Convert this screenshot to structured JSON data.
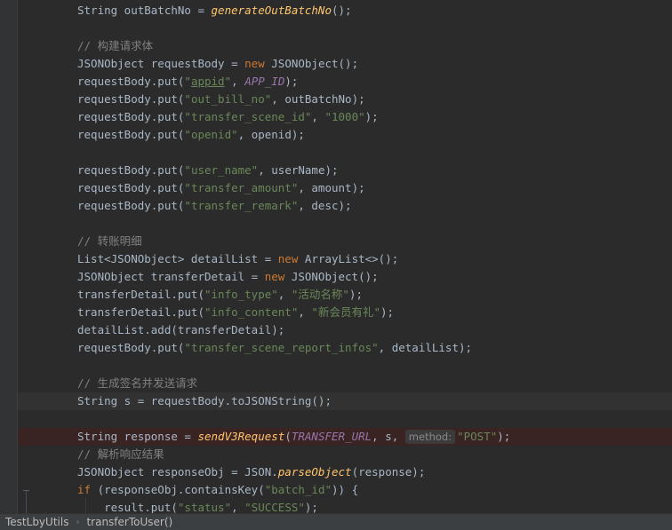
{
  "editor": {
    "lines": [
      {
        "parts": [
          [
            "t",
            "String outBatchNo = "
          ],
          [
            "mi",
            "generateOutBatchNo"
          ],
          [
            "t",
            "();"
          ]
        ]
      },
      {
        "parts": []
      },
      {
        "parts": [
          [
            "c",
            "// 构建请求体"
          ]
        ]
      },
      {
        "parts": [
          [
            "t",
            "JSONObject requestBody = "
          ],
          [
            "k",
            "new "
          ],
          [
            "t",
            "JSONObject();"
          ]
        ]
      },
      {
        "parts": [
          [
            "t",
            "requestBody.put("
          ],
          [
            "s",
            "\""
          ],
          [
            "su",
            "appid"
          ],
          [
            "s",
            "\""
          ],
          [
            "t",
            ", "
          ],
          [
            "ci",
            "APP_ID"
          ],
          [
            "t",
            ");"
          ]
        ]
      },
      {
        "parts": [
          [
            "t",
            "requestBody.put("
          ],
          [
            "s",
            "\"out_bill_no\""
          ],
          [
            "t",
            ", outBatchNo);"
          ]
        ]
      },
      {
        "parts": [
          [
            "t",
            "requestBody.put("
          ],
          [
            "s",
            "\"transfer_scene_id\""
          ],
          [
            "t",
            ", "
          ],
          [
            "s",
            "\"1000\""
          ],
          [
            "t",
            ");"
          ]
        ]
      },
      {
        "parts": [
          [
            "t",
            "requestBody.put("
          ],
          [
            "s",
            "\"openid\""
          ],
          [
            "t",
            ", openid);"
          ]
        ]
      },
      {
        "parts": []
      },
      {
        "parts": [
          [
            "t",
            "requestBody.put("
          ],
          [
            "s",
            "\"user_name\""
          ],
          [
            "t",
            ", userName);"
          ]
        ]
      },
      {
        "parts": [
          [
            "t",
            "requestBody.put("
          ],
          [
            "s",
            "\"transfer_amount\""
          ],
          [
            "t",
            ", amount);"
          ]
        ]
      },
      {
        "parts": [
          [
            "t",
            "requestBody.put("
          ],
          [
            "s",
            "\"transfer_remark\""
          ],
          [
            "t",
            ", desc);"
          ]
        ]
      },
      {
        "parts": []
      },
      {
        "parts": [
          [
            "c",
            "// 转账明细"
          ]
        ]
      },
      {
        "parts": [
          [
            "t",
            "List<JSONObject> detailList = "
          ],
          [
            "k",
            "new "
          ],
          [
            "t",
            "ArrayList<>();"
          ]
        ]
      },
      {
        "parts": [
          [
            "t",
            "JSONObject transferDetail = "
          ],
          [
            "k",
            "new "
          ],
          [
            "t",
            "JSONObject();"
          ]
        ]
      },
      {
        "parts": [
          [
            "t",
            "transferDetail.put("
          ],
          [
            "s",
            "\"info_type\""
          ],
          [
            "t",
            ", "
          ],
          [
            "s",
            "\"活动名称\""
          ],
          [
            "t",
            ");"
          ]
        ]
      },
      {
        "parts": [
          [
            "t",
            "transferDetail.put("
          ],
          [
            "s",
            "\"info_content\""
          ],
          [
            "t",
            ", "
          ],
          [
            "s",
            "\"新会员有礼\""
          ],
          [
            "t",
            ");"
          ]
        ]
      },
      {
        "parts": [
          [
            "t",
            "detailList.add(transferDetail);"
          ]
        ]
      },
      {
        "parts": [
          [
            "t",
            "requestBody.put("
          ],
          [
            "s",
            "\"transfer_scene_report_infos\""
          ],
          [
            "t",
            ", detailList);"
          ]
        ]
      },
      {
        "parts": []
      },
      {
        "parts": [
          [
            "c",
            "// 生成签名并发送请求"
          ]
        ]
      },
      {
        "parts": [
          [
            "t",
            "String s = requestBody.toJSONString();"
          ]
        ],
        "current": true
      },
      {
        "parts": []
      },
      {
        "parts": [
          [
            "t",
            "String response = "
          ],
          [
            "mi",
            "sendV3Request"
          ],
          [
            "t",
            "("
          ],
          [
            "ci",
            "TRANSFER_URL"
          ],
          [
            "t",
            ", s, "
          ],
          [
            "h",
            "method:"
          ],
          [
            "s",
            "\"POST\""
          ],
          [
            "t",
            ");"
          ]
        ],
        "breakpoint": true
      },
      {
        "parts": [
          [
            "c",
            "// 解析响应结果"
          ]
        ]
      },
      {
        "parts": [
          [
            "t",
            "JSONObject responseObj = JSON."
          ],
          [
            "mi",
            "parseObject"
          ],
          [
            "t",
            "(response);"
          ]
        ]
      },
      {
        "parts": [
          [
            "k",
            "if "
          ],
          [
            "t",
            "(responseObj.containsKey("
          ],
          [
            "s",
            "\"batch_id\""
          ],
          [
            "t",
            ")) {"
          ]
        ]
      },
      {
        "parts": [
          [
            "t",
            "    result.put("
          ],
          [
            "s",
            "\"status\""
          ],
          [
            "t",
            ", "
          ],
          [
            "s",
            "\"SUCCESS\""
          ],
          [
            "t",
            ");"
          ]
        ]
      }
    ]
  },
  "breadcrumb": {
    "file": "TestLbyUtils",
    "method": "transferToUser()"
  },
  "colors": {
    "background": "#2b2b2b",
    "keyword": "#cc7832",
    "string": "#6a8759",
    "method": "#ffc66d",
    "constant": "#9876aa",
    "comment": "#808080"
  }
}
